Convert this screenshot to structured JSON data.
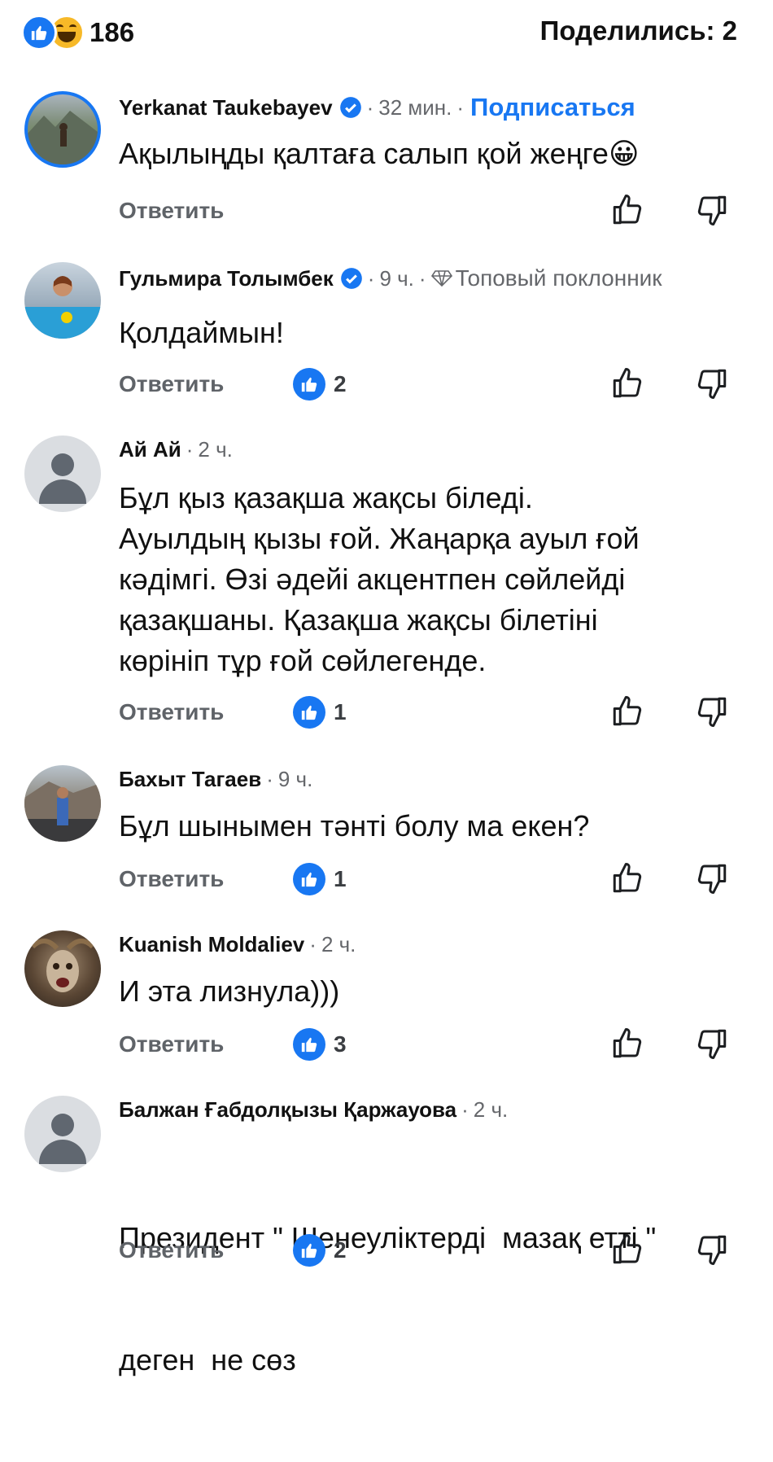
{
  "header": {
    "reactions_count": "186",
    "shares_label": "Поделились: 2",
    "reaction_icons": [
      "like-icon",
      "haha-icon"
    ]
  },
  "colors": {
    "accent": "#1877f2",
    "secondary_text": "#65676b"
  },
  "comments": [
    {
      "author": "Yerkanat Taukebayev",
      "verified": true,
      "time": "32 мин.",
      "extra": "Подписаться",
      "text": "Ақылыңды қалтаға салып қой жеңге😀",
      "reply_label": "Ответить",
      "likes": ""
    },
    {
      "author": "Гульмира Толымбек",
      "verified": true,
      "time": "9 ч.",
      "extra": "Топовый поклонник",
      "text": "Қолдаймын!",
      "reply_label": "Ответить",
      "likes": "2"
    },
    {
      "author": "Ай Ай",
      "verified": false,
      "time": "2 ч.",
      "extra": "",
      "text_lines": [
        "Бұл қыз қазақша жақсы біледі.",
        "Ауылдың қызы ғой. Жаңарқа ауыл ғой",
        "кәдімгі. Өзі әдейі акцентпен сөйлейді",
        "қазақшаны. Қазақша жақсы білетіні",
        "көрініп тұр ғой сөйлегенде."
      ],
      "reply_label": "Ответить",
      "likes": "1"
    },
    {
      "author": "Бахыт Тагаев",
      "verified": false,
      "time": "9 ч.",
      "extra": "",
      "text": "Бұл шынымен тәнті болу ма екен?",
      "reply_label": "Ответить",
      "likes": "1"
    },
    {
      "author": "Kuanish Moldaliev",
      "verified": false,
      "time": "2 ч.",
      "extra": "",
      "text": "И эта лизнула)))",
      "reply_label": "Ответить",
      "likes": "3"
    },
    {
      "author": "Балжан Ғабдолқызы Қаржауова",
      "verified": false,
      "time": "2 ч.",
      "extra": "",
      "text_lines": [
        "Президент \" Шенеуліктерді  мазақ етті \"",
        "деген  не сөз"
      ],
      "reply_label": "Ответить",
      "likes": "2"
    }
  ]
}
